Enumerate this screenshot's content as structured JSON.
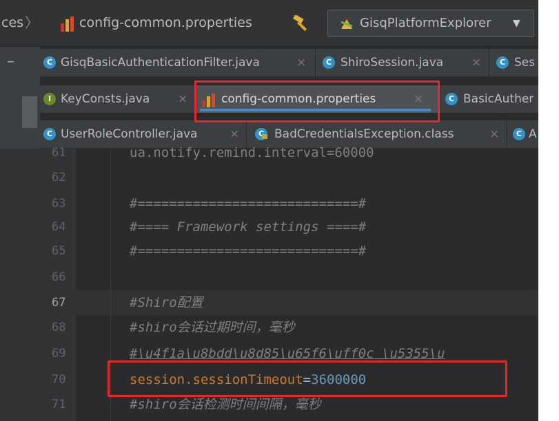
{
  "navbar": {
    "breadcrumb_prev": "ces",
    "breadcrumb_sep": "〉",
    "file_name": "config-common.properties",
    "build_icon": "hammer-icon",
    "run_config": {
      "label": "GisqPlatformExplorer",
      "caret": "▼"
    }
  },
  "tabs": {
    "close_glyph": "×",
    "row1": [
      {
        "label": "GisqBasicAuthenticationFilter.java",
        "icon": "C"
      },
      {
        "label": "ShiroSession.java",
        "icon": "C"
      },
      {
        "label": "Ses",
        "icon": "C"
      }
    ],
    "row2": [
      {
        "label": "KeyConsts.java",
        "icon": "I"
      },
      {
        "label": "config-common.properties",
        "icon": "properties-icon",
        "active": true
      },
      {
        "label": "BasicAuther",
        "icon": "C"
      }
    ],
    "row3": [
      {
        "label": "UserRoleController.java",
        "icon": "C"
      },
      {
        "label": "BadCredentialsException.class",
        "icon": "C"
      },
      {
        "label": "A",
        "icon": "C"
      }
    ]
  },
  "editor": {
    "lines": [
      {
        "num": "61",
        "text": "ua.notify.remind.interval=60000"
      },
      {
        "num": "62",
        "text": ""
      },
      {
        "num": "63",
        "text": "#============================#"
      },
      {
        "num": "64",
        "text": "#==== Framework settings ====#"
      },
      {
        "num": "65",
        "text": "#============================#"
      },
      {
        "num": "66",
        "text": ""
      },
      {
        "num": "67",
        "text": "#Shiro配置"
      },
      {
        "num": "68",
        "text": "#shiro会话过期时间，毫秒"
      },
      {
        "num": "69",
        "text": "#\\u4f1a\\u8bdd\\u8d85\\u65f6\\uff0c \\u5355\\u"
      },
      {
        "num": "70",
        "key": "session.sessionTimeout",
        "eq": "=",
        "value": "3600000"
      },
      {
        "num": "71",
        "text": "#shiro会话检测时间间隔，毫秒"
      }
    ]
  },
  "colors": {
    "annotation": "#e8262b",
    "active_tab_underline": "#4a88c7",
    "class_icon": "#3592c4"
  }
}
